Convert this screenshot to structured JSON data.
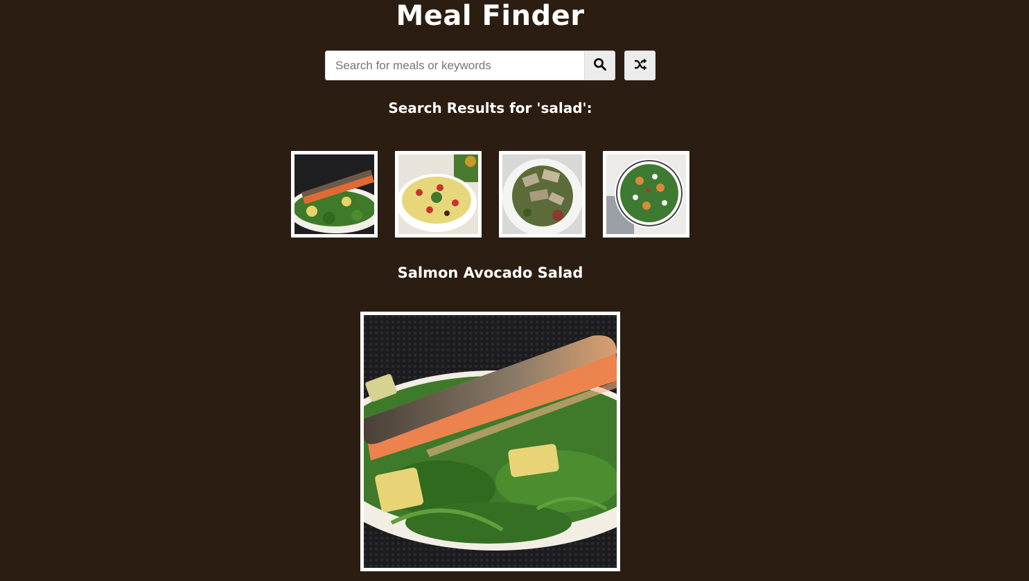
{
  "header": {
    "title": "Meal Finder"
  },
  "search": {
    "placeholder": "Search for meals or keywords",
    "value": "",
    "search_icon": "search-icon",
    "random_icon": "shuffle-icon"
  },
  "results": {
    "heading": "Search Results for 'salad':",
    "items": [
      {
        "icon": "salmon-salad-photo"
      },
      {
        "icon": "pasta-salad-photo"
      },
      {
        "icon": "chicken-salad-photo"
      },
      {
        "icon": "green-salad-bowl-photo"
      }
    ]
  },
  "selected_meal": {
    "name": "Salmon Avocado Salad",
    "image_icon": "salmon-avocado-salad-photo"
  },
  "colors": {
    "background": "#2b1d12",
    "text": "#ffffff",
    "button": "#ececec"
  }
}
